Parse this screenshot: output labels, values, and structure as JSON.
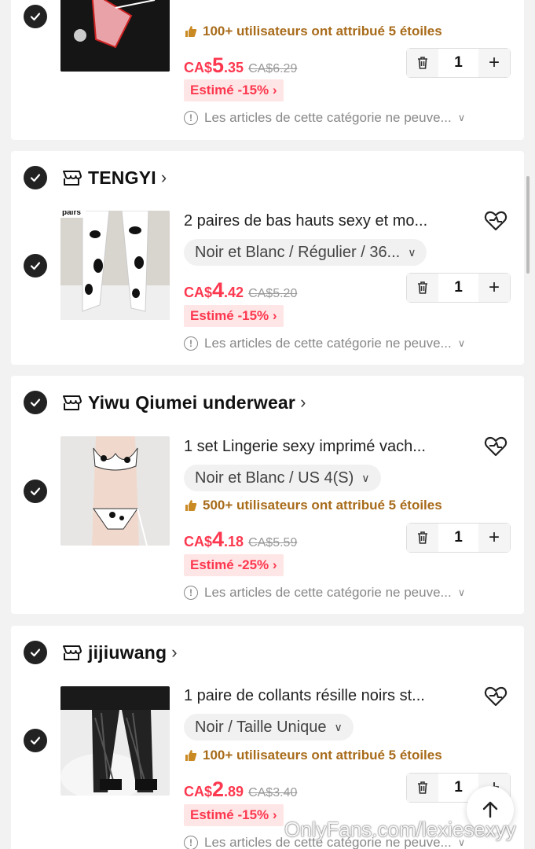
{
  "cart": {
    "items": [
      {
        "rating": "100+ utilisateurs ont attribué 5 étoiles",
        "price_cur": "CA$",
        "price_int": "5",
        "price_dec": ".35",
        "price_old": "CA$6.29",
        "discount": "Estimé -15% ›",
        "qty": "1",
        "note": "Les articles de cette catégorie ne peuve..."
      },
      {
        "store": "TENGYI",
        "title": "2 paires de bas hauts sexy et mo...",
        "variant": "Noir et Blanc / Régulier / 36...",
        "price_cur": "CA$",
        "price_int": "4",
        "price_dec": ".42",
        "price_old": "CA$5.20",
        "discount": "Estimé -15% ›",
        "qty": "1",
        "note": "Les articles de cette catégorie ne peuve...",
        "thumb_label": "pairs"
      },
      {
        "store": "Yiwu Qiumei underwear",
        "title": "1 set Lingerie sexy imprimé vach...",
        "variant": "Noir et Blanc / US 4(S)",
        "rating": "500+ utilisateurs ont attribué 5 étoiles",
        "price_cur": "CA$",
        "price_int": "4",
        "price_dec": ".18",
        "price_old": "CA$5.59",
        "discount": "Estimé -25% ›",
        "qty": "1",
        "note": "Les articles de cette catégorie ne peuve..."
      },
      {
        "store": "jijiuwang",
        "title": "1 paire de collants résille noirs st...",
        "variant": "Noir / Taille Unique",
        "rating": "100+ utilisateurs ont attribué 5 étoiles",
        "price_cur": "CA$",
        "price_int": "2",
        "price_dec": ".89",
        "price_old": "CA$3.40",
        "discount": "Estimé -15% ›",
        "qty": "1",
        "note": "Les articles de cette catégorie ne peuve..."
      }
    ]
  },
  "watermark": "OnlyFans.com/lexiesexyy",
  "colors": {
    "price": "#fd384f",
    "rating": "#a86b1a",
    "discount_bg": "#ffe6e6"
  }
}
